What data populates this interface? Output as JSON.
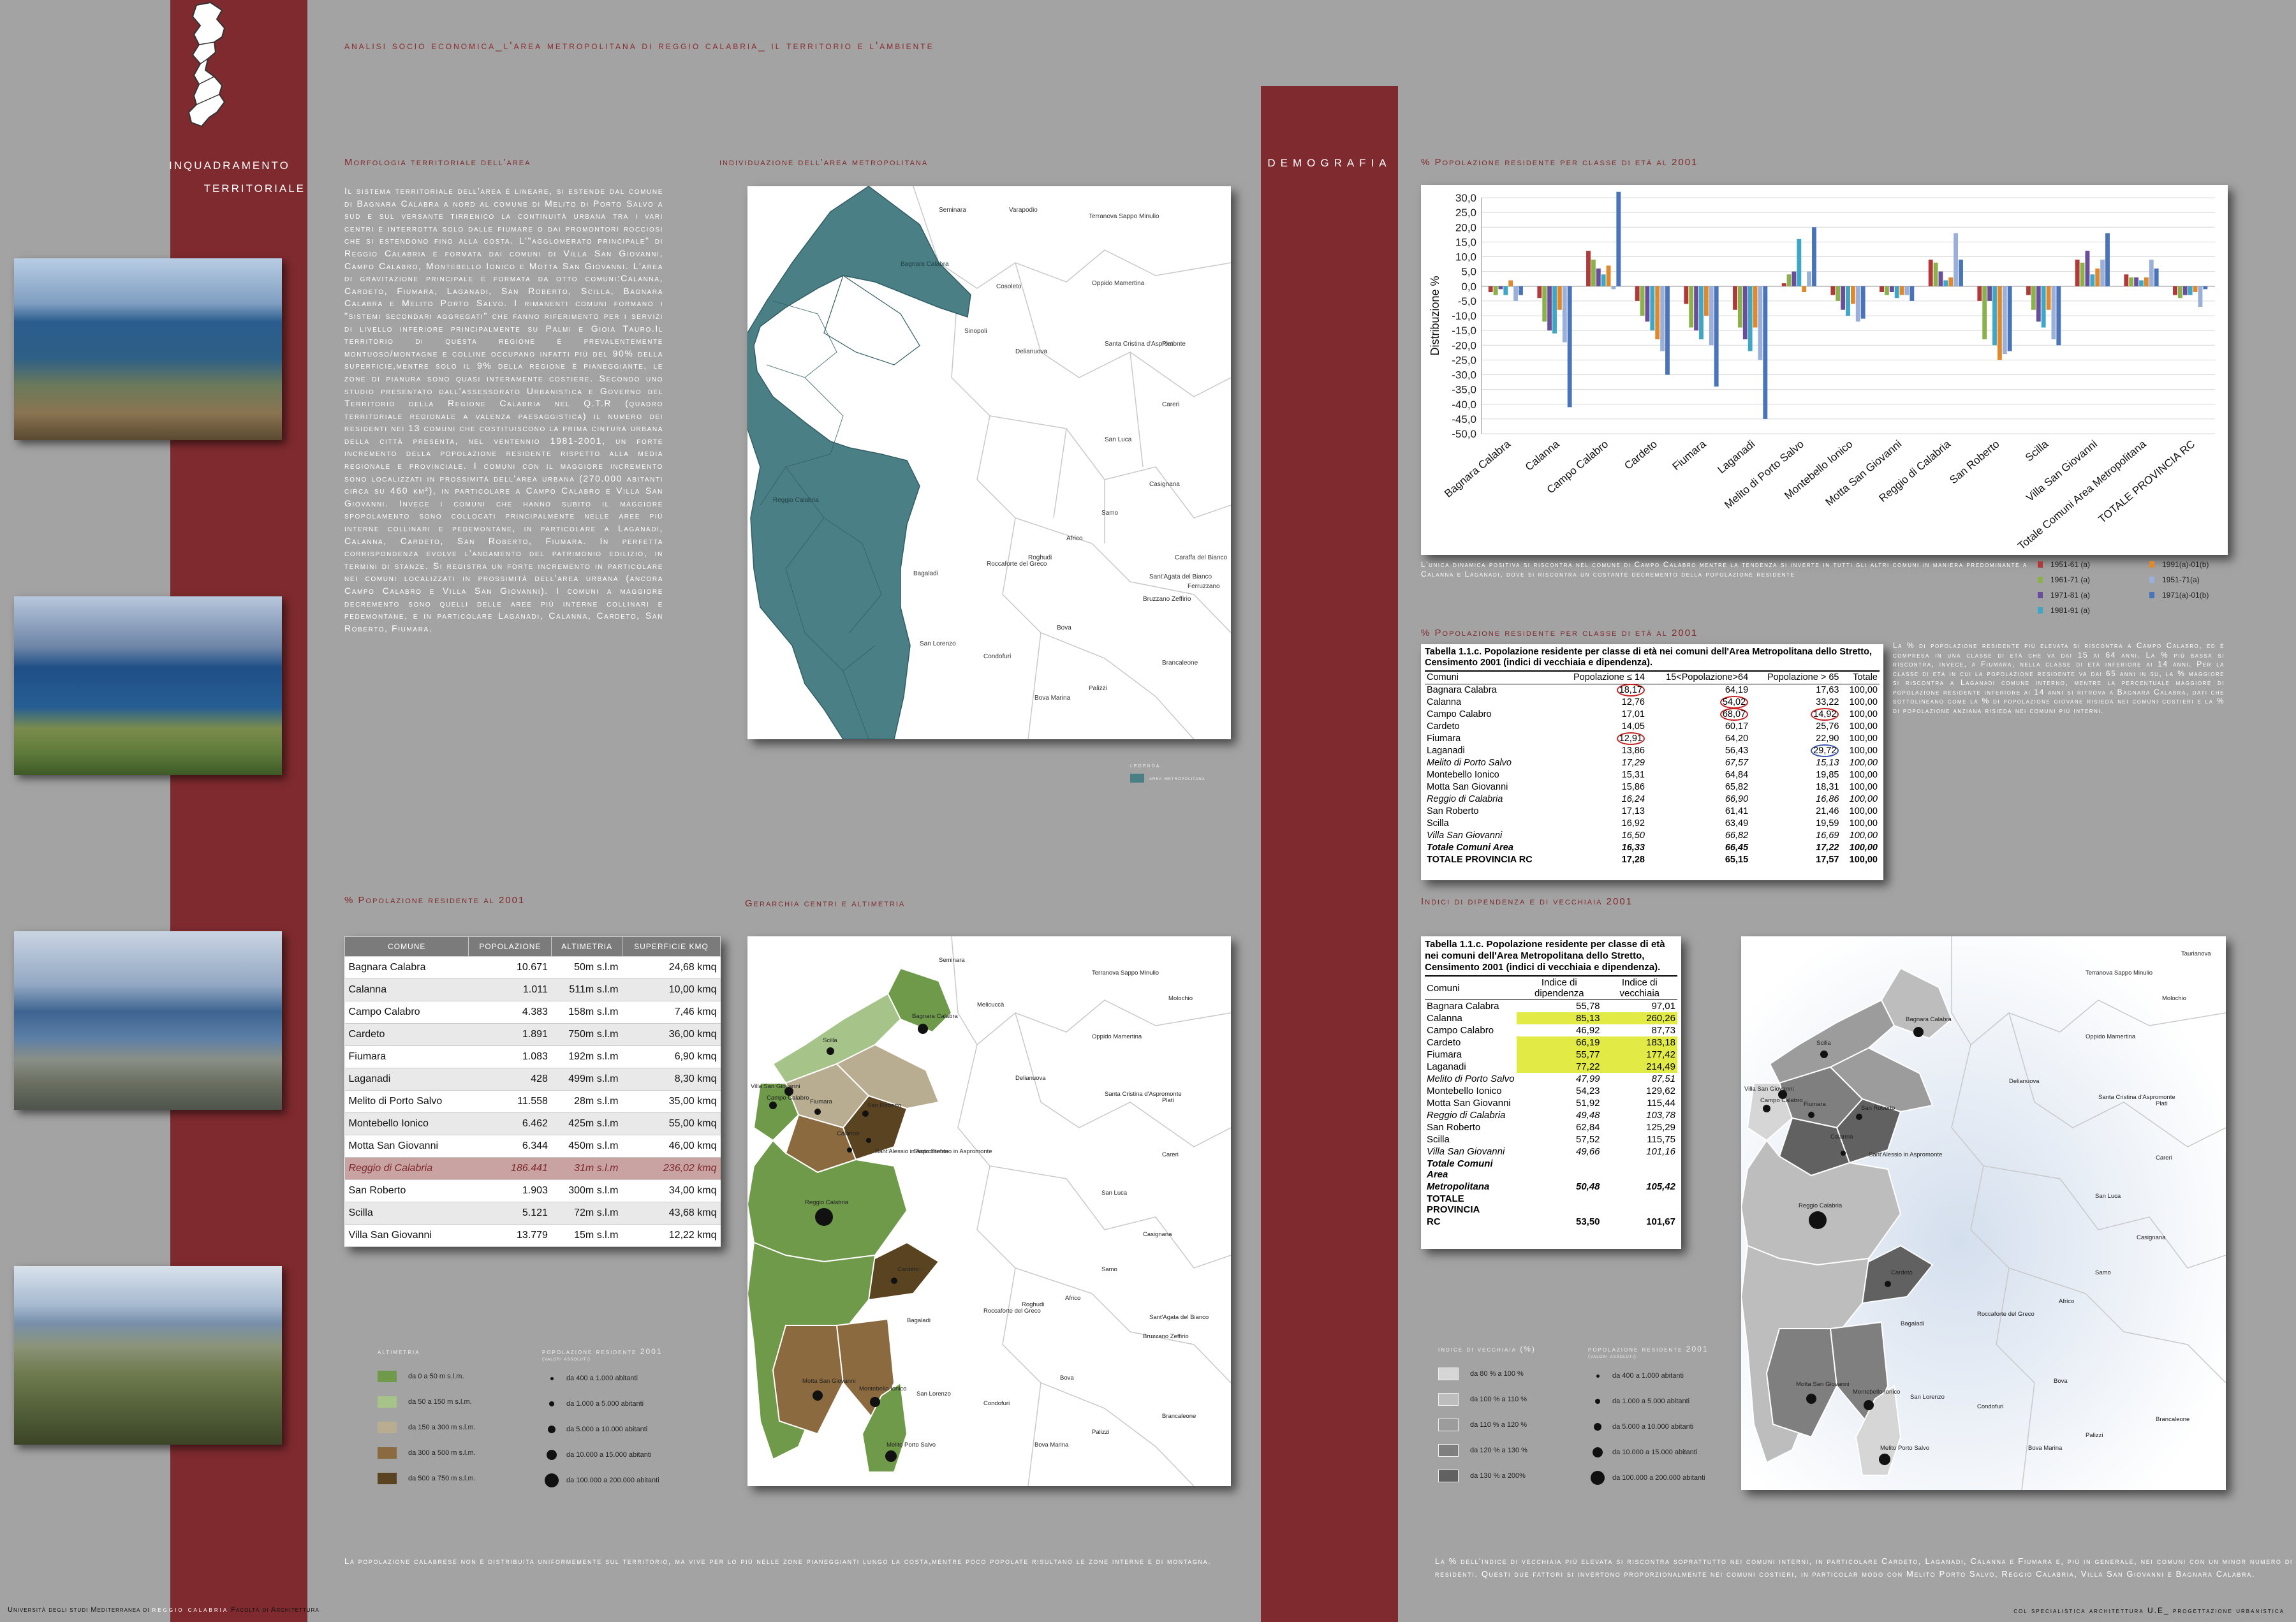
{
  "header": {
    "title": "analisi socio economica_l'area metropolitana di reggio calabria_ il territorio e l'ambiente",
    "side_title_1": "inquadramento",
    "side_title_2": "territoriale",
    "demografia": "demografia"
  },
  "footer": {
    "left_a": "Università degli studi Mediterranea di",
    "left_b": "reggio calabria",
    "left_c": "Facoltà di Architettura",
    "right": "col specialistica architettura U.E_ progettazione urbanistica"
  },
  "sections": {
    "morfologia": "Morfologia territoriale dell'area",
    "individuazione": "individuazione dell'area metropolitana",
    "popolazione2001": "% Popolazione residente al 2001",
    "gerarchia": "Gerarchia centri e altimetria",
    "eta2001_a": "% Popolazione residente per classe di età al 2001",
    "eta2001_b": "% Popolazione residente per classe di età al 2001",
    "indici": "Indici di dipendenza e di vecchiaia 2001"
  },
  "morfologia_text": "Il sistema territoriale dell'area è lineare, si estende dal comune di Bagnara Calabra a nord al comune di Melito di Porto Salvo a sud e sul versante tirrenico la continuità urbana tra i vari centri è interrotta solo dalle fiumare o dai promontori rocciosi che si estendono fino alla costa. L'\"agglomerato principale\" di Reggio Calabria è formata dai comuni di Villa San Giovanni, Campo Calabro, Montebello Ionico e Motta San Giovanni. L'area di gravitazione principale è formata da otto comuni:Calanna, Cardeto, Fiumara, Laganadi, San Roberto, Scilla, Bagnara Calabra e Melito Porto Salvo. I rimanenti comuni formano i \"sistemi secondari aggregati\" che fanno riferimento per i servizi di livello inferiore principalmente su Palmi e Gioia Tauro.Il territorio di questa regione è prevalentemente montuoso/montagne e colline occupano infatti più del 90% della superficie,mentre solo il 9% della regione è pianeggiante, le zone di pianura sono quasi interamente costiere. Secondo uno studio presentato dall'assessorato Urbanistica e Governo del Territorio della Regione Calabria nel Q.T.R (quadro territoriale regionale a valenza paesaggistica) il numero dei residenti nei 13 comuni che costituiscono la prima cintura urbana della città presenta, nel ventennio 1981-2001, un forte incremento della popolazione residente rispetto alla media regionale e provinciale. I comuni con il maggiore incremento sono localizzati in prossimità dell'area urbana (270.000 abitanti circa su 460 km²), in particolare a Campo Calabro e Villa San Giovanni. Invece i comuni che hanno subito il maggiore spopolamento sono collocati principalmente nelle aree più interne collinari e pedemontane, in particolare a Laganadi, Calanna, Cardeto, San Roberto, Fiumara. In perfetta corrispondenza evolve l'andamento del patrimonio edilizio, in termini di stanze. Si registra un forte incremento in particolare nei comuni localizzati in prossimità dell'area urbana (ancora Campo Calabro e Villa San Giovanni). I comuni a maggiore decremento sono quelli delle aree più interne collinari e pedemontane, e in particolare Laganadi, Calanna, Cardeto, San Roberto, Fiumara.",
  "pop_table": {
    "headers": [
      "comune",
      "popolazione",
      "altimetria",
      "superficie kmq"
    ],
    "rows": [
      [
        "Bagnara Calabra",
        "10.671",
        "50m s.l.m",
        "24,68 kmq"
      ],
      [
        "Calanna",
        "1.011",
        "511m s.l.m",
        "10,00 kmq"
      ],
      [
        "Campo Calabro",
        "4.383",
        "158m s.l.m",
        "7,46 kmq"
      ],
      [
        "Cardeto",
        "1.891",
        "750m s.l.m",
        "36,00 kmq"
      ],
      [
        "Fiumara",
        "1.083",
        "192m s.l.m",
        "6,90 kmq"
      ],
      [
        "Laganadi",
        "428",
        "499m s.l.m",
        "8,30 kmq"
      ],
      [
        "Melito di Porto Salvo",
        "11.558",
        "28m s.l.m",
        "35,00 kmq"
      ],
      [
        "Montebello Ionico",
        "6.462",
        "425m s.l.m",
        "55,00 kmq"
      ],
      [
        "Motta San Giovanni",
        "6.344",
        "450m s.l.m",
        "46,00 kmq"
      ],
      [
        "Reggio di Calabria",
        "186.441",
        "31m s.l.m",
        "236,02 kmq"
      ],
      [
        "San Roberto",
        "1.903",
        "300m s.l.m",
        "34,00 kmq"
      ],
      [
        "Scilla",
        "5.121",
        "72m s.l.m",
        "43,68 kmq"
      ],
      [
        "Villa San Giovanni",
        "13.779",
        "15m s.l.m",
        "12,22 kmq"
      ]
    ]
  },
  "legend_area": {
    "title": "legenda",
    "item": "area metropolitana"
  },
  "legend_altimetria": {
    "title": "altimetria",
    "items": [
      "da 0 a 50 m s.l.m.",
      "da 50 a 150 m s.l.m.",
      "da 150 a 300 m s.l.m.",
      "da 300 a 500 m s.l.m.",
      "da 500 a 750 m s.l.m."
    ],
    "colors": [
      "#6f9a4a",
      "#a6c48a",
      "#b9ad91",
      "#8c6a3f",
      "#5a4320"
    ]
  },
  "legend_popolazione": {
    "title": "popolazione residente 2001",
    "subtitle": "(valori assoluti)",
    "items": [
      "da 400 a 1.000 abitanti",
      "da 1.000 a 5.000 abitanti",
      "da 5.000 a 10.000 abitanti",
      "da 10.000 a 15.000 abitanti",
      "da 100.000 a 200.000 abitanti"
    ]
  },
  "legend_vecchiaia": {
    "title": "indice di vecchiaia (%)",
    "items": [
      "da 80 % a 100 %",
      "da 100 % a 110 %",
      "da 110 % a 120 %",
      "da 120 % a 130 %",
      "da 130 % a 200%"
    ],
    "colors": [
      "#d6d6d6",
      "#bdbdbd",
      "#9c9c9c",
      "#7f7f7f",
      "#616161"
    ]
  },
  "legend_popolazione_2": {
    "title": "popolazione residente 2001",
    "subtitle": "(valori assoluti)",
    "items": [
      "da 400 a 1.000 abitanti",
      "da 1.000 a 5.000 abitanti",
      "da 5.000 a 10.000 abitanti",
      "da 10.000 a 15.000 abitanti",
      "da 100.000 a 200.000 abitanti"
    ]
  },
  "map_labels": {
    "seminara": "Seminara",
    "varapodio": "Varapodio",
    "terranova": "Terranova Sappo Minulio",
    "molochio": "Molochio",
    "melicucca": "Melicuccà",
    "san_procopio": "San Procopio",
    "cosoleto": "Cosoleto",
    "oppido": "Oppido Mamertina",
    "bagnara": "Bagnara Calabra",
    "scilla": "Scilla",
    "villa": "Villa San Giovanni",
    "campo": "Campo Calabro",
    "fiumara": "Fiumara",
    "san_roberto": "San Roberto",
    "calanna": "Calanna",
    "laganadi": "Laganadi",
    "santa_eufemia": "Santa Eufemia d'Aspromonte",
    "sinopoli": "Sinopoli",
    "delianuova": "Delianuova",
    "santa_cristina": "Santa Cristina d'Aspromonte",
    "plati": "Platì",
    "careri": "Careri",
    "reggio": "Reggio Calabria",
    "cardeto": "Cardeto",
    "san_luca": "San Luca",
    "casignana": "Casignana",
    "samo": "Samo",
    "africo": "Africo",
    "bagaladi": "Bagaladi",
    "roccaforte": "Roccaforte del Greco",
    "roghudi": "Roghudi",
    "caraffa": "Caraffa del Bianco",
    "santagata": "Sant'Agata del Bianco",
    "ferruzzano": "Ferruzzano",
    "bruzzano": "Bruzzano Zeffirio",
    "motta": "Motta San Giovanni",
    "montebello": "Montebello Ionico",
    "melito": "Melito Porto Salvo",
    "san_lorenzo": "San Lorenzo",
    "condofuri": "Condofuri",
    "bova": "Bova",
    "bova_marina": "Bova Marina",
    "palizzi": "Palizzi",
    "brancaleone": "Brancaleone",
    "santo_stefano": "Santo Stefano in Aspromonte",
    "sant_alessio": "Sant'Alessio in Aspromonte",
    "taurianova": "Taurianova"
  },
  "chart_caption": "L'unica dinamica positiva si riscontra nel comune di Campo Calabro mentre la tendenza si inverte in tutti gli altri comuni in maniera predominante a Calanna e Laganadi, dove si riscontra un costante decremento della popolazione residente",
  "chart_data": {
    "type": "bar",
    "ylabel": "Distribuzione %",
    "ylim": [
      -50,
      30
    ],
    "yticks": [
      "30,0",
      "25,0",
      "20,0",
      "15,0",
      "10,0",
      "5,0",
      "0,0",
      "-5,0",
      "-10,0",
      "-15,0",
      "-20,0",
      "-25,0",
      "-30,0",
      "-35,0",
      "-40,0",
      "-45,0",
      "-50,0"
    ],
    "categories": [
      "Bagnara Calabra",
      "Calanna",
      "Campo Calabro",
      "Cardeto",
      "Fiumara",
      "Laganadi",
      "Melito di Porto Salvo",
      "Montebello Ionico",
      "Motta San Giovanni",
      "Reggio di Calabria",
      "San Roberto",
      "Scilla",
      "Villa San Giovanni",
      "Totale Comuni Area Metropolitana",
      "TOTALE PROVINCIA RC"
    ],
    "series": [
      {
        "name": "1951-61 (a)",
        "color": "#b03a3a",
        "values": [
          -2,
          -4,
          12,
          -5,
          -6,
          -8,
          1,
          -3,
          -2,
          9,
          -5,
          -3,
          9,
          4,
          -3
        ]
      },
      {
        "name": "1961-71 (a)",
        "color": "#8bb24a",
        "values": [
          -3,
          -12,
          9,
          -10,
          -14,
          -14,
          4,
          -5,
          -3,
          8,
          -18,
          -8,
          8,
          3,
          -4
        ]
      },
      {
        "name": "1971-81 (a)",
        "color": "#6a4e9b",
        "values": [
          -1,
          -15,
          6,
          -12,
          -15,
          -18,
          5,
          -8,
          -2,
          5,
          -5,
          -12,
          12,
          3,
          -3
        ]
      },
      {
        "name": "1981-91 (a)",
        "color": "#3fa7c6",
        "values": [
          -3,
          -16,
          4,
          -15,
          -18,
          -22,
          16,
          -10,
          -4,
          2,
          -20,
          -14,
          4,
          2,
          -3
        ]
      },
      {
        "name": "1991(a)-01(b)",
        "color": "#e0892c",
        "values": [
          2,
          -8,
          7,
          -18,
          -10,
          -14,
          -2,
          -6,
          -3,
          3,
          -25,
          -8,
          6,
          3,
          -2
        ]
      },
      {
        "name": "1951-71(a)",
        "color": "#9bb0d8",
        "values": [
          -5,
          -19,
          -1,
          -22,
          -20,
          -25,
          5,
          -12,
          -3,
          18,
          -23,
          -18,
          9,
          9,
          -7
        ]
      },
      {
        "name": "1971(a)-01(b)",
        "color": "#4a74b9",
        "values": [
          -3,
          -41,
          32,
          -30,
          -34,
          -45,
          20,
          -11,
          -5,
          9,
          -22,
          -20,
          18,
          6,
          -1
        ]
      }
    ]
  },
  "age_table": {
    "title": "Tabella 1.1.c. Popolazione residente per classe di età nei comuni dell'Area Metropolitana dello Stretto, Censimento 2001 (indici di vecchiaia e dipendenza).",
    "headers": [
      "Comuni",
      "Popolazione ≤ 14",
      "15<Popolazione>64",
      "Popolazione > 65",
      "Totale"
    ],
    "rows": [
      [
        "Bagnara Calabra",
        "18,17",
        "64,19",
        "17,63",
        "100,00"
      ],
      [
        "Calanna",
        "12,76",
        "54,02",
        "33,22",
        "100,00"
      ],
      [
        "Campo Calabro",
        "17,01",
        "68,07",
        "14,92",
        "100,00"
      ],
      [
        "Cardeto",
        "14,05",
        "60,17",
        "25,76",
        "100,00"
      ],
      [
        "Fiumara",
        "12,91",
        "64,20",
        "22,90",
        "100,00"
      ],
      [
        "Laganadi",
        "13,86",
        "56,43",
        "29,72",
        "100,00"
      ],
      [
        "Melito di Porto Salvo",
        "17,29",
        "67,57",
        "15,13",
        "100,00"
      ],
      [
        "Montebello Ionico",
        "15,31",
        "64,84",
        "19,85",
        "100,00"
      ],
      [
        "Motta San Giovanni",
        "15,86",
        "65,82",
        "18,31",
        "100,00"
      ],
      [
        "Reggio di Calabria",
        "16,24",
        "66,90",
        "16,86",
        "100,00"
      ],
      [
        "San Roberto",
        "17,13",
        "61,41",
        "21,46",
        "100,00"
      ],
      [
        "Scilla",
        "16,92",
        "63,49",
        "19,59",
        "100,00"
      ],
      [
        "Villa San Giovanni",
        "16,50",
        "66,82",
        "16,69",
        "100,00"
      ],
      [
        "Totale Comuni Area",
        "16,33",
        "66,45",
        "17,22",
        "100,00"
      ],
      [
        "TOTALE PROVINCIA RC",
        "17,28",
        "65,15",
        "17,57",
        "100,00"
      ]
    ]
  },
  "age_text": "La % di popolazione residente più elevata si riscontra a Campo Calabro, ed è compresa in una classe di età che va dai 15 ai 64 anni. La % più bassa si riscontra, invece, a Fiumara, nella classe di età inferiore ai 14 anni. Per la classe di età in cui la popolazione residente va dai 65 anni in su, la % maggiore si riscontra a Laganadi comune interno, mentre la percentuale maggiore di popolazione residente inferiore ai 14 anni si ritrova a Bagnara Calabra, dati che sottolineano come la % di popolazione giovane risieda nei comuni costieri e la % di popolazione anziana risieda nei comuni più interni.",
  "dep_table": {
    "title": "Tabella 1.1.c. Popolazione residente per classe di età nei comuni dell'Area Metropolitana dello Stretto, Censimento 2001 (indici di vecchiaia e dipendenza).",
    "headers": [
      "Comuni",
      "Indice di dipendenza",
      "Indice di vecchiaia"
    ],
    "rows": [
      [
        "Bagnara Calabra",
        "55,78",
        "97,01"
      ],
      [
        "Calanna",
        "85,13",
        "260,26"
      ],
      [
        "Campo Calabro",
        "46,92",
        "87,73"
      ],
      [
        "Cardeto",
        "66,19",
        "183,18"
      ],
      [
        "Fiumara",
        "55,77",
        "177,42"
      ],
      [
        "Laganadi",
        "77,22",
        "214,49"
      ],
      [
        "Melito di Porto Salvo",
        "47,99",
        "87,51"
      ],
      [
        "Montebello Ionico",
        "54,23",
        "129,62"
      ],
      [
        "Motta San Giovanni",
        "51,92",
        "115,44"
      ],
      [
        "Reggio di Calabria",
        "49,48",
        "103,78"
      ],
      [
        "San Roberto",
        "62,84",
        "125,29"
      ],
      [
        "Scilla",
        "57,52",
        "115,75"
      ],
      [
        "Villa San Giovanni",
        "49,66",
        "101,16"
      ],
      [
        "Totale Comuni Area",
        "",
        ""
      ],
      [
        "Metropolitana",
        "50,48",
        "105,42"
      ],
      [
        "TOTALE PROVINCIA",
        "",
        ""
      ],
      [
        "RC",
        "53,50",
        "101,67"
      ]
    ]
  },
  "bottom_text_left": "La popolazione calabrese non è distribuita uniformemente sul territorio, ma vive per lo più nelle zone pianeggianti lungo la costa,mentre poco popolate risultano le zone interne e di montagna.",
  "bottom_text_right": "La % dell'indice di vecchiaia più elevata si riscontra soprattutto nei comuni interni, in particolare Cardeto, Laganadi, Calanna e Fiumara e, più in generale, nei comuni con un minor numero di residenti. Questi due fattori si invertono proporzionalmente nei comuni costieri, in particolar modo con Melito Porto Salvo, Reggio Calabria, Villa San Giovanni e Bagnara Calabra."
}
